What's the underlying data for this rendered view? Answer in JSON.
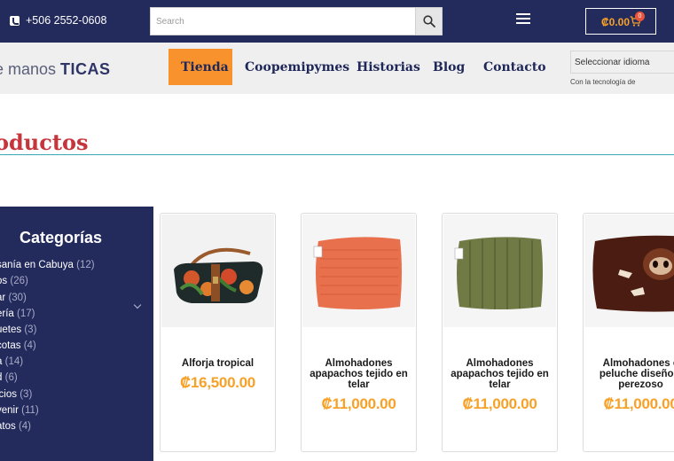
{
  "topbar": {
    "phone": "+506 2552-0608",
    "search_placeholder": "Search",
    "cart_amount": "₡0.00",
    "cart_count": "0"
  },
  "header": {
    "logo_light": "e manos ",
    "logo_bold": "TICAS",
    "nav": [
      {
        "label": "Tienda",
        "active": true
      },
      {
        "label": "Coopemipymes"
      },
      {
        "label": "Historias"
      },
      {
        "label": "Blog"
      },
      {
        "label": "Contacto"
      }
    ],
    "language_select": "Seleccionar idioma",
    "powered_by": "Con la tecnología de"
  },
  "main": {
    "title": "oductos"
  },
  "sidebar": {
    "title": "Categorías",
    "items": [
      {
        "label": "sanía en Cabuya",
        "count": "(12)"
      },
      {
        "label": "os",
        "count": "(26)"
      },
      {
        "label": "ar",
        "count": "(30)"
      },
      {
        "label": "ería",
        "count": "(17)"
      },
      {
        "label": "uetes",
        "count": "(3)"
      },
      {
        "label": "cotas",
        "count": "(4)"
      },
      {
        "label": "a",
        "count": "(14)"
      },
      {
        "label": "d",
        "count": "(6)"
      },
      {
        "label": "icios",
        "count": "(3)"
      },
      {
        "label": "venir",
        "count": "(11)"
      },
      {
        "label": "atos",
        "count": "(4)"
      }
    ]
  },
  "products": [
    {
      "name": "Alforja tropical",
      "price": "₡16,500.00"
    },
    {
      "name": "Almohadones apapachos tejido en telar",
      "price": "₡11,000.00"
    },
    {
      "name": "Almohadones apapachos tejido en telar",
      "price": "₡11,000.00"
    },
    {
      "name": "Almohadones c peluche diseño e perezoso",
      "price": "₡11,000.00"
    }
  ],
  "colors": {
    "navy": "#232a5c",
    "orange": "#f7922c",
    "price": "#f7a128",
    "title_red": "#c6353c",
    "teal_line": "#3aa7b5"
  }
}
